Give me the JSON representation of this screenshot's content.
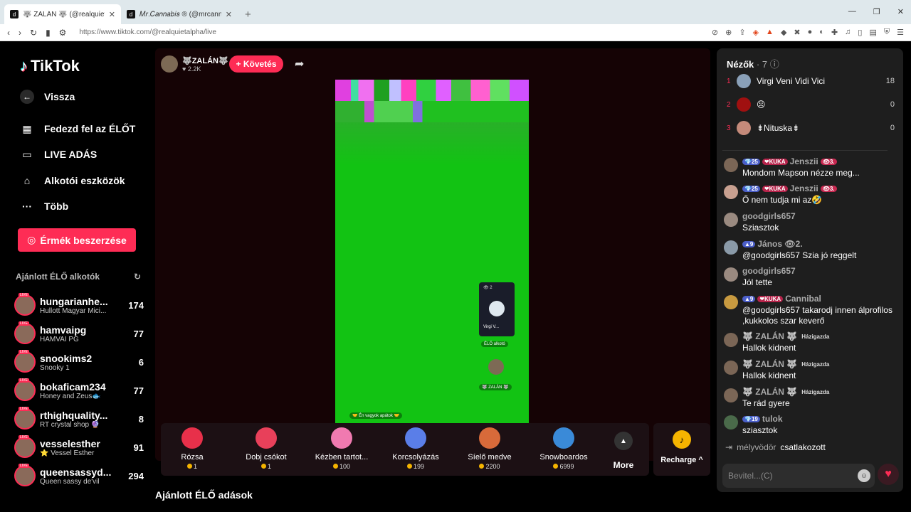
{
  "browser": {
    "tabs": [
      {
        "title": "🐺 ZALÁN 🐺 (@realquietalpha)",
        "icon": "d"
      },
      {
        "title": "𝑀𝑟.𝐶𝑎𝑛𝑛𝑎𝑏𝑖𝑠 ® (@mrcannabis_)",
        "icon": "d"
      }
    ],
    "new_tab": "+",
    "url": "https://www.tiktok.com/@realquietalpha/live",
    "window_controls": [
      "—",
      "❐",
      "✕"
    ]
  },
  "sidebar": {
    "brand": "TikTok",
    "nav": [
      {
        "label": "Vissza",
        "icon": "←"
      },
      {
        "label": "Fedezd fel az ÉLŐT",
        "icon": "▦"
      },
      {
        "label": "LIVE ADÁS",
        "icon": "▭"
      },
      {
        "label": "Alkotói eszközök",
        "icon": "⌂"
      },
      {
        "label": "Több",
        "icon": "···"
      }
    ],
    "coins_button": "Érmék beszerzése",
    "recommended_header": "Ajánlott ÉLŐ alkotók",
    "live_badge": "LIVE",
    "creators": [
      {
        "name": "hungarianhe...",
        "sub": "Hullott Magyar Mici...",
        "count": "174"
      },
      {
        "name": "hamvaipg",
        "sub": "HAMVAI PG",
        "count": "77"
      },
      {
        "name": "snookims2",
        "sub": "Snooky 1",
        "count": "6"
      },
      {
        "name": "bokaficam234",
        "sub": "Honey and Zeus🐟",
        "count": "77"
      },
      {
        "name": "rthighquality...",
        "sub": "RT crystal shop 🔮",
        "count": "8"
      },
      {
        "name": "vesselesther",
        "sub": "⭐ Vessel Esther",
        "count": "91"
      },
      {
        "name": "queensassyd...",
        "sub": "Queen sassy de'vil",
        "count": "294"
      }
    ]
  },
  "stream": {
    "host_name": "🐺ZALÁN🐺",
    "host_likes": "♥ 2.2K",
    "follow": "+ Követés",
    "pip_count": "👁 2",
    "pip_name": "Virgi V...",
    "pip_tag": "ÉLŐ alkotó",
    "host_tag": "🐺 ZALÁN 🐺",
    "caption": "🤝 Én vagyok apátok 🤝",
    "gifts": [
      {
        "name": "Rózsa",
        "price": "1",
        "color": "#e8304a"
      },
      {
        "name": "Dobj csókot",
        "price": "1",
        "color": "#e8405a"
      },
      {
        "name": "Kézben tartot...",
        "price": "100",
        "color": "#f07ab0"
      },
      {
        "name": "Korcsolyázás",
        "price": "199",
        "color": "#5a7ee8"
      },
      {
        "name": "Síelő medve",
        "price": "2200",
        "color": "#d86a3a"
      },
      {
        "name": "Snowboardos",
        "price": "6999",
        "color": "#3a8ad8"
      }
    ],
    "more": "More",
    "recharge": "Recharge ^",
    "recommended_live": "Ajánlott ÉLŐ adások"
  },
  "chat": {
    "viewers_title": "Nézők",
    "viewers_count": "· 7",
    "top_viewers": [
      {
        "rank": "1",
        "name": "Virgi Veni Vidi Vici",
        "score": "18"
      },
      {
        "rank": "2",
        "name": "☹",
        "score": "0"
      },
      {
        "rank": "3",
        "name": "⇟Nituska⇟",
        "score": "0"
      }
    ],
    "messages": [
      {
        "badges": [
          "💎25",
          "❤KUKA",
          "👁3."
        ],
        "user": "Jenszii",
        "text": "Mondom Mapson nézze meg..."
      },
      {
        "badges": [
          "💎25",
          "❤KUKA",
          "👁3."
        ],
        "user": "Jenszii",
        "text": "Ő nem tudja mi az🤣"
      },
      {
        "badges": [],
        "user": "goodgirls657",
        "text": "Sziasztok"
      },
      {
        "badges": [
          "▲9"
        ],
        "user": "János 👁2.",
        "text": "@goodgirls657 Szia jó reggelt"
      },
      {
        "badges": [],
        "user": "goodgirls657",
        "text": "Jól tette"
      },
      {
        "badges": [
          "▲9",
          "❤KUKA"
        ],
        "user": "Cannibal",
        "text": "@goodgirls657 takarodj innen álprofilos ,kukkolos szar keverő"
      },
      {
        "badges": [],
        "user": "🐺 ZALÁN 🐺",
        "tag": "Házigazda",
        "text": "Hallok kidnent"
      },
      {
        "badges": [],
        "user": "🐺 ZALÁN 🐺",
        "tag": "Házigazda",
        "text": "Hallok kidnent"
      },
      {
        "badges": [],
        "user": "🐺 ZALÁN 🐺",
        "tag": "Házigazda",
        "text": "Te rád gyere"
      },
      {
        "badges": [
          "💎19"
        ],
        "user": "tulok",
        "text": "sziasztok"
      }
    ],
    "joined_user": "mélyvödör",
    "joined_text": "csatlakozott",
    "input_placeholder": "Bevitel...(C)"
  }
}
